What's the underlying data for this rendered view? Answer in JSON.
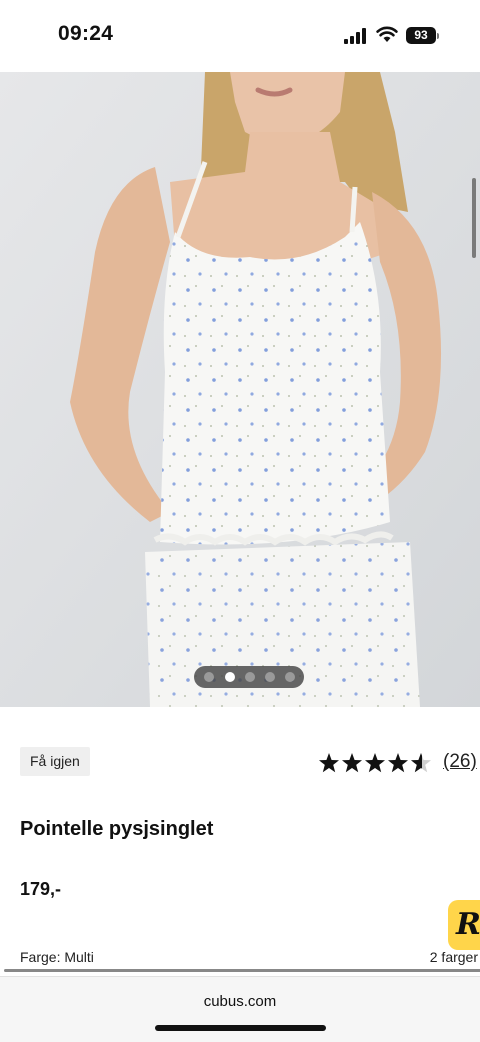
{
  "status_bar": {
    "time": "09:24",
    "battery": "93",
    "icons": [
      "cellular-signal-icon",
      "wifi-icon",
      "battery-icon"
    ]
  },
  "product": {
    "badge": "Få igjen",
    "rating": 4.5,
    "rating_max": 5,
    "review_count": "(26)",
    "title": "Pointelle pysjsinglet",
    "price": "179,-",
    "color_label": "Farge: Multi",
    "colors_count": "2 farger"
  },
  "gallery": {
    "image_count": 5,
    "active_index": 1,
    "image_description_icon": "product-photo"
  },
  "chat": {
    "glyph": "R"
  },
  "browser": {
    "url": "cubus.com"
  },
  "colors": {
    "star": "#111111",
    "badge_bg": "#efefef",
    "chat_bg": "#ffd54a",
    "hero_bg": "#dfe1e3"
  }
}
